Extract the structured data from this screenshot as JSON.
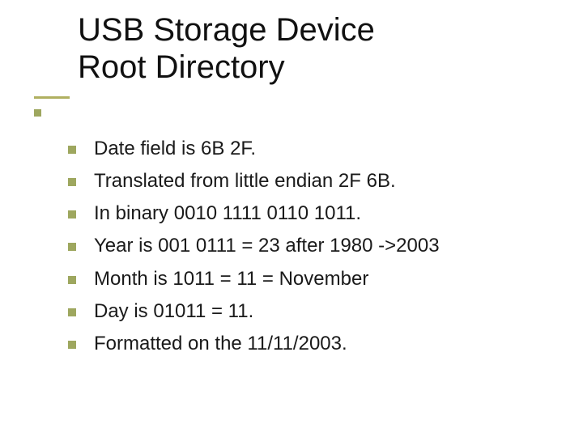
{
  "title_line1": "USB Storage Device",
  "title_line2": "Root Directory",
  "bullets": [
    "Date field is 6B 2F.",
    "Translated from little endian 2F 6B.",
    "In binary 0010 1111 0110 1011.",
    "Year is 001 0111 = 23 after 1980 ->2003",
    "Month is 1011 = 11 = November",
    "Day is 01011 = 11.",
    "Formatted on the 11/11/2003."
  ]
}
